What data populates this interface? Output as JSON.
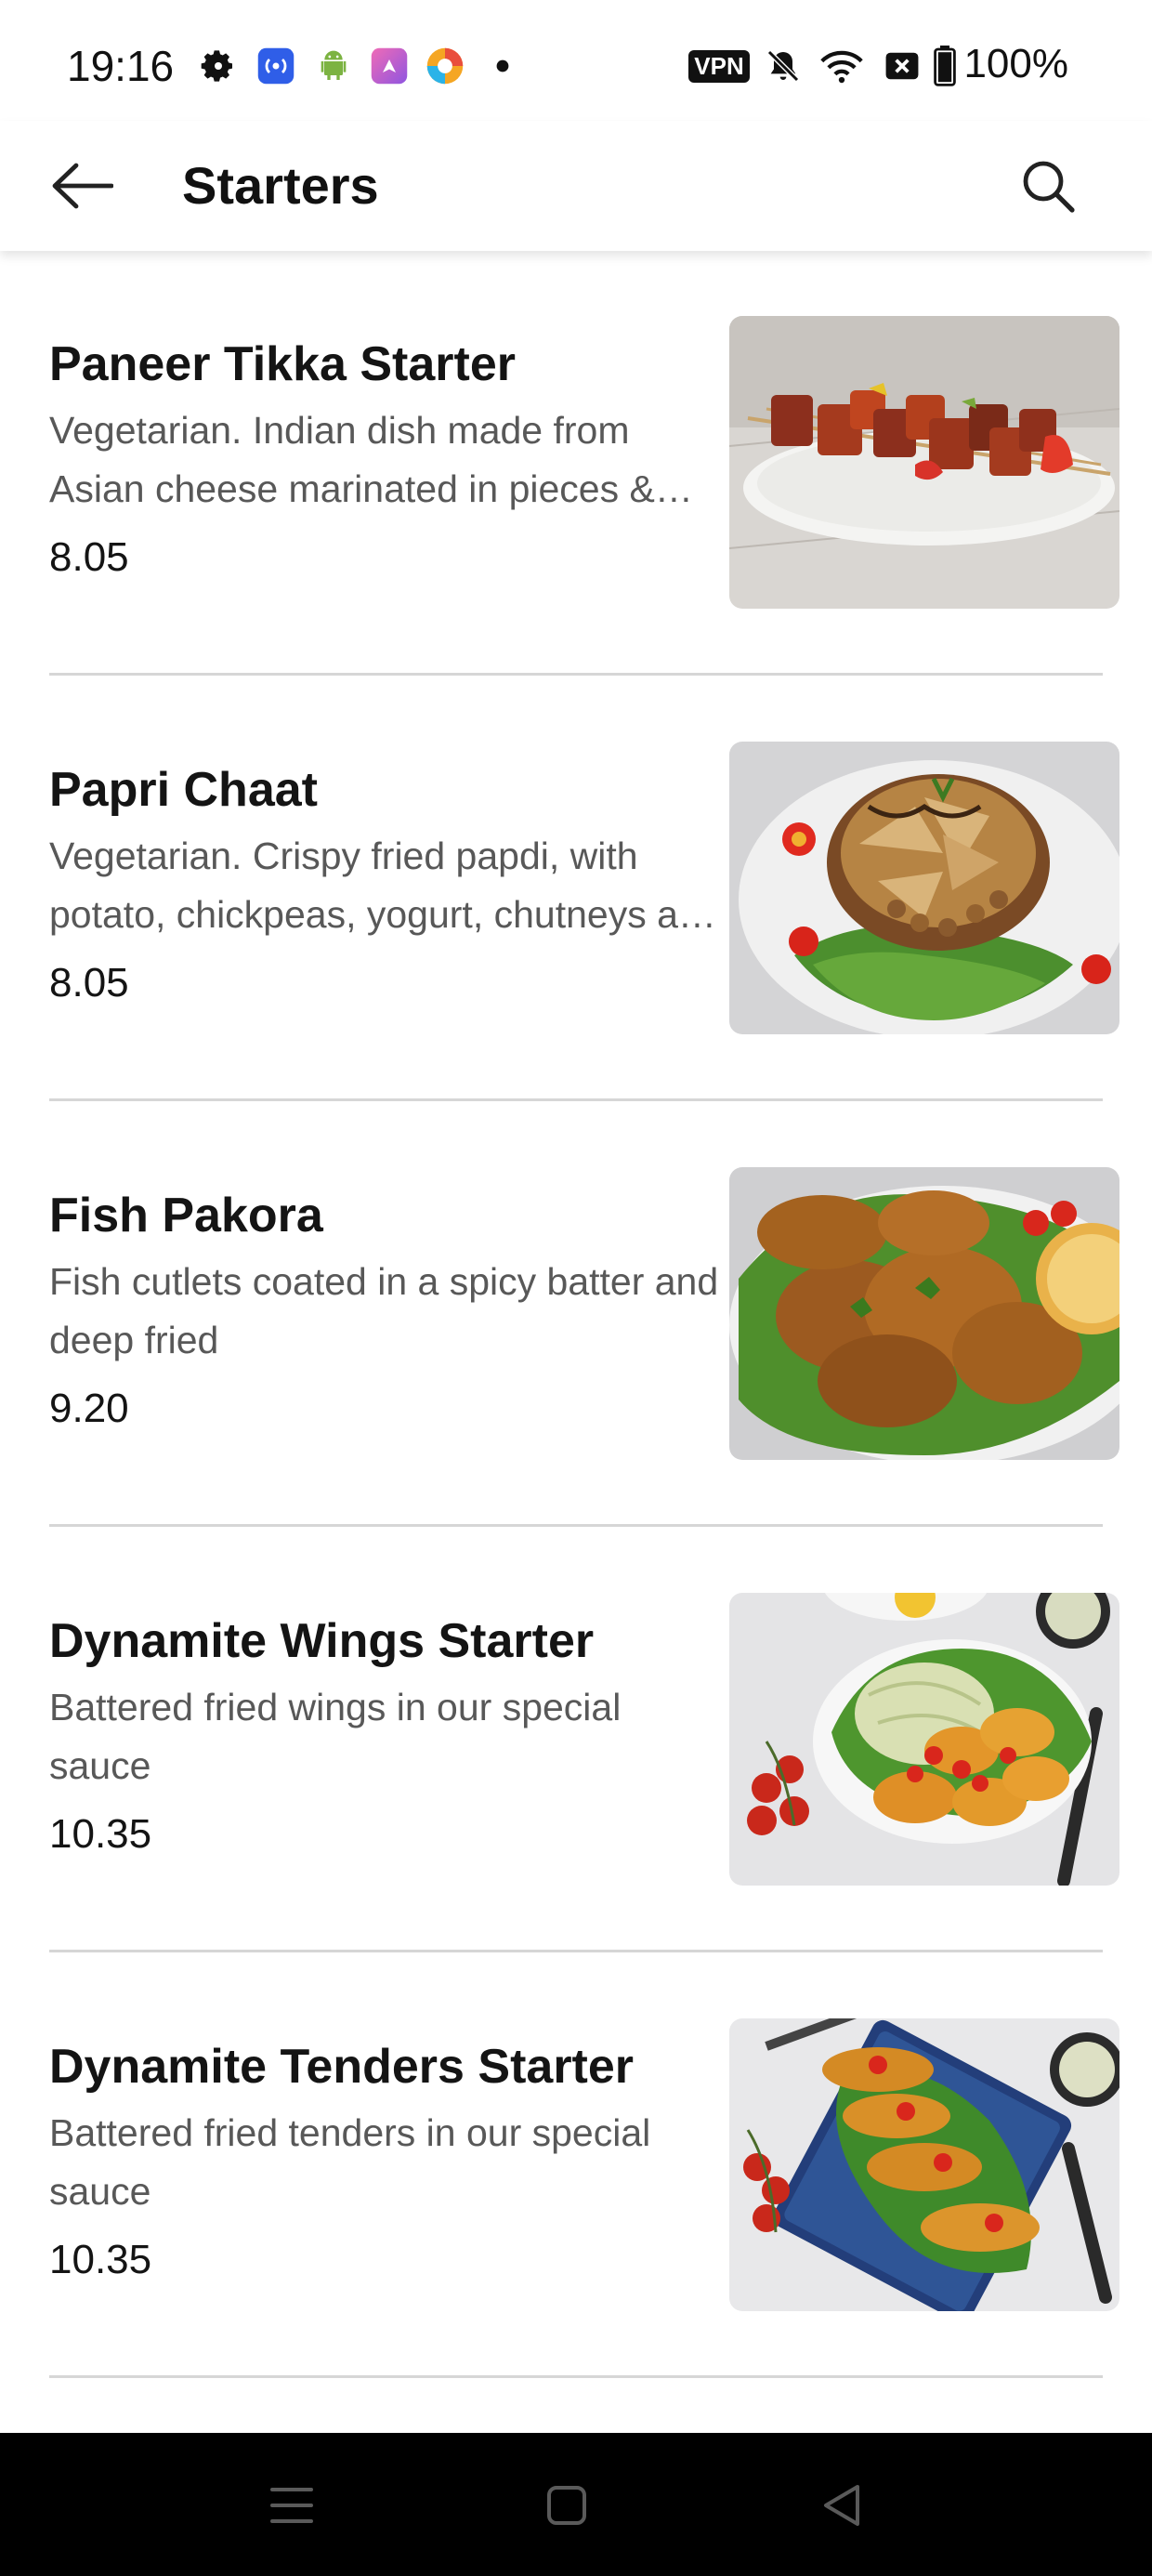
{
  "status_bar": {
    "time": "19:16",
    "battery_percent": "100%",
    "vpn_label": "VPN",
    "icons": [
      "gear-icon",
      "signal-app-icon",
      "android-icon",
      "shortcut-app-icon",
      "browser-icon",
      "dot-icon",
      "mute-icon",
      "wifi-icon",
      "close-box-icon",
      "battery-icon"
    ]
  },
  "app_bar": {
    "title": "Starters",
    "back_icon": "back-arrow-icon",
    "search_icon": "search-icon"
  },
  "menu_items": [
    {
      "name": "Paneer Tikka Starter",
      "description": "Vegetarian. Indian dish made from Asian cheese marinated in pieces & gr…",
      "price": "8.05"
    },
    {
      "name": "Papri Chaat",
      "description": "Vegetarian. Crispy fried papdi, with potato, chickpeas, yogurt, chutneys a…",
      "price": "8.05"
    },
    {
      "name": "Fish Pakora",
      "description": "Fish cutlets coated in a spicy batter and deep fried",
      "price": "9.20"
    },
    {
      "name": "Dynamite Wings Starter",
      "description": "Battered fried wings in our special sauce",
      "price": "10.35"
    },
    {
      "name": "Dynamite Tenders Starter",
      "description": "Battered fried tenders in our special sauce",
      "price": "10.35"
    }
  ],
  "nav_bar": {
    "icons": [
      "menu-icon",
      "home-icon",
      "back-icon"
    ]
  },
  "colors": {
    "text_primary": "#141414",
    "text_secondary": "#585858",
    "divider": "#d6d6d6",
    "nav_background": "#000000"
  }
}
